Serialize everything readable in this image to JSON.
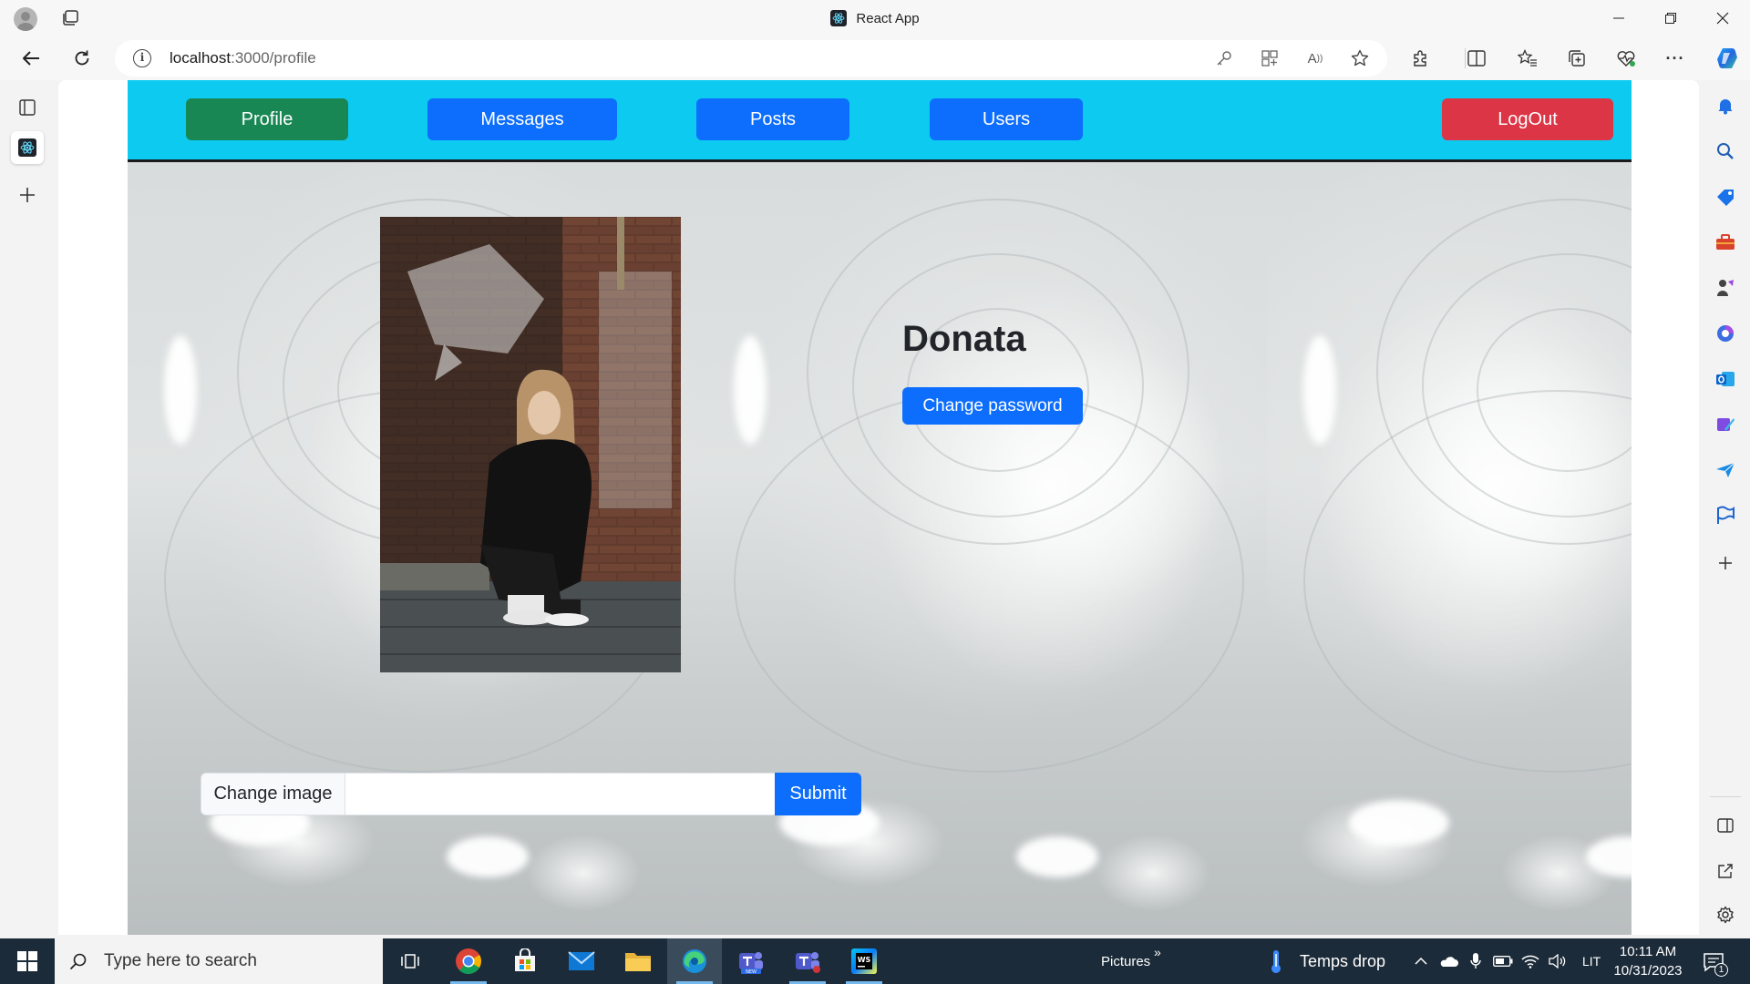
{
  "browser": {
    "window_title": "React App",
    "url_host": "localhost",
    "url_path": ":3000/profile"
  },
  "app": {
    "nav": {
      "profile_label": "Profile",
      "messages_label": "Messages",
      "posts_label": "Posts",
      "users_label": "Users",
      "logout_label": "LogOut"
    },
    "profile": {
      "name": "Donata",
      "change_password_label": "Change password",
      "change_image_label": "Change image",
      "image_url_value": "",
      "submit_label": "Submit"
    }
  },
  "taskbar": {
    "search_placeholder": "Type here to search",
    "pictures_label": "Pictures",
    "weather_label": "Temps drop",
    "language": "LIT",
    "time": "10:11 AM",
    "date": "10/31/2023",
    "notification_count": "1"
  },
  "colors": {
    "app_nav_bg": "#0dcaf0",
    "primary": "#0d6efd",
    "success": "#198754",
    "danger": "#dc3545"
  },
  "icons": [
    "profile-avatar-icon",
    "tab-actions-icon",
    "react-favicon-icon",
    "minimize-icon",
    "restore-icon",
    "close-icon",
    "back-icon",
    "refresh-icon",
    "info-icon",
    "key-icon",
    "app-available-icon",
    "read-aloud-icon",
    "favorite-star-icon",
    "extensions-icon",
    "split-screen-icon",
    "favorites-icon",
    "collections-icon",
    "browser-essentials-icon",
    "more-icon",
    "copilot-icon",
    "vertical-tabs-icon",
    "new-tab-icon",
    "bell-icon",
    "search-icon",
    "shopping-icon",
    "tools-icon",
    "games-icon",
    "microsoft365-icon",
    "outlook-icon",
    "designer-icon",
    "send-icon",
    "flag-icon",
    "add-icon",
    "sidebar-toggle-icon",
    "open-external-icon",
    "settings-icon",
    "windows-start-icon",
    "task-view-icon",
    "chrome-icon",
    "store-icon",
    "mail-icon",
    "file-explorer-icon",
    "edge-icon",
    "teams-new-icon",
    "teams-icon",
    "webstorm-icon",
    "thermometer-icon",
    "chevron-up-icon",
    "onedrive-icon",
    "microphone-icon",
    "battery-icon",
    "wifi-icon",
    "volume-icon",
    "notification-icon"
  ]
}
